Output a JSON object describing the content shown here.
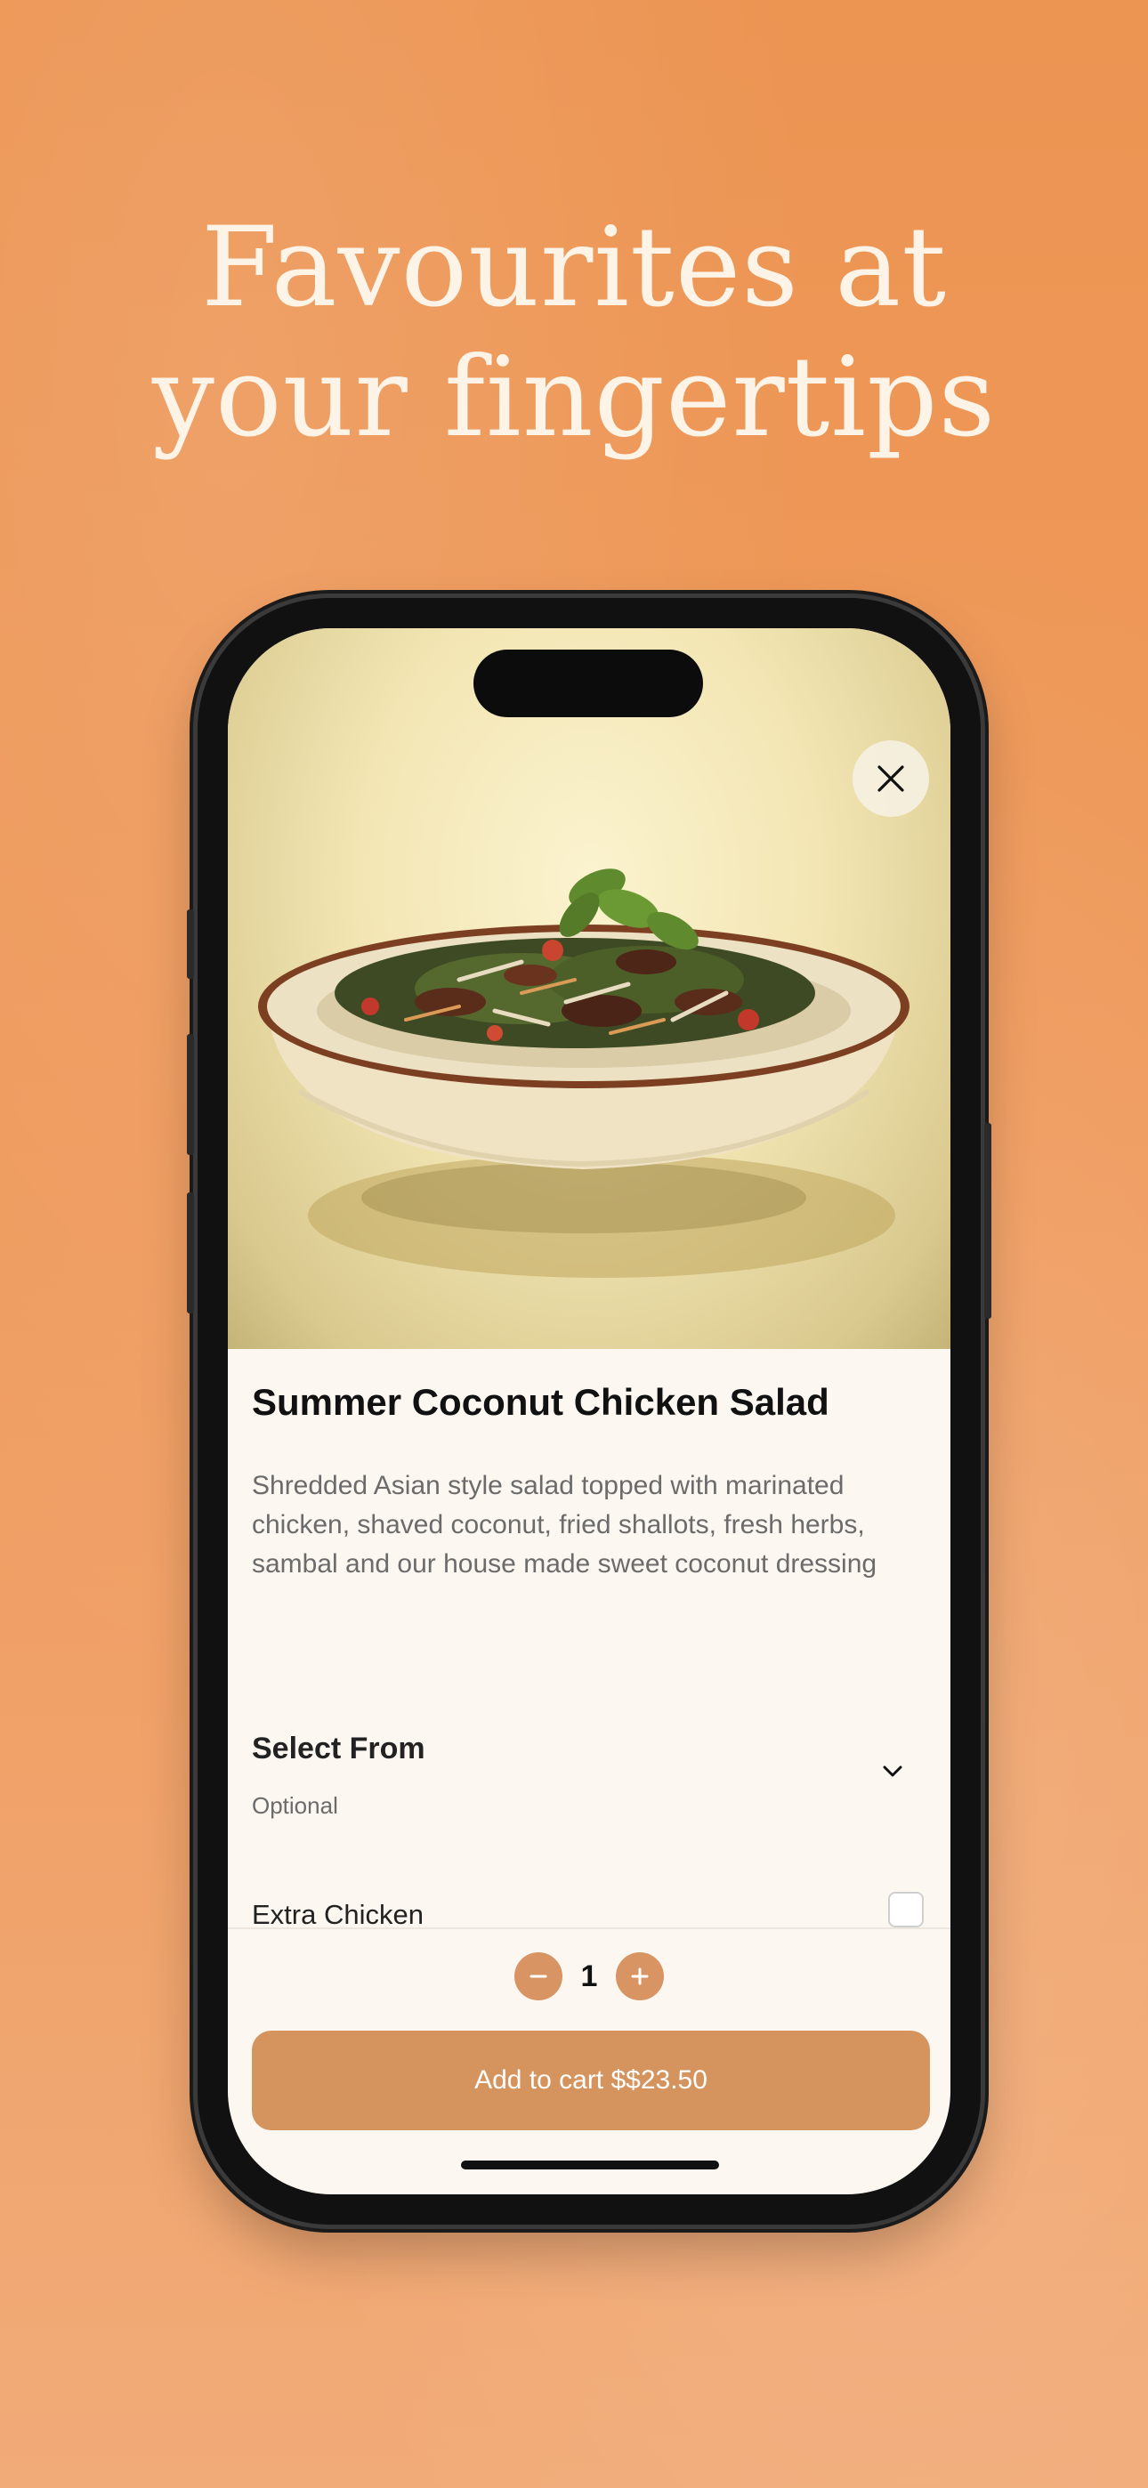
{
  "headline": {
    "line1": "Favourites at",
    "line2": "your fingertips"
  },
  "colors": {
    "background": "#ef9a5c",
    "headline": "#fdf3e6",
    "accent": "#d5945d",
    "sheet": "#fdf7f1"
  },
  "product": {
    "title": "Summer Coconut Chicken Salad",
    "description": "Shredded Asian style salad topped with marinated chicken, shaved coconut, fried shallots, fresh herbs, sambal and our house made sweet coconut dressing"
  },
  "options": {
    "group_title": "Select From",
    "group_subtitle": "Optional",
    "items": [
      {
        "label": "Extra Chicken",
        "checked": false
      }
    ]
  },
  "quantity": {
    "value": "1"
  },
  "cart": {
    "button_label": "Add to cart $$23.50"
  },
  "icons": {
    "close": "close-icon",
    "chevron": "chevron-down-icon",
    "minus": "minus-icon",
    "plus": "plus-icon"
  }
}
